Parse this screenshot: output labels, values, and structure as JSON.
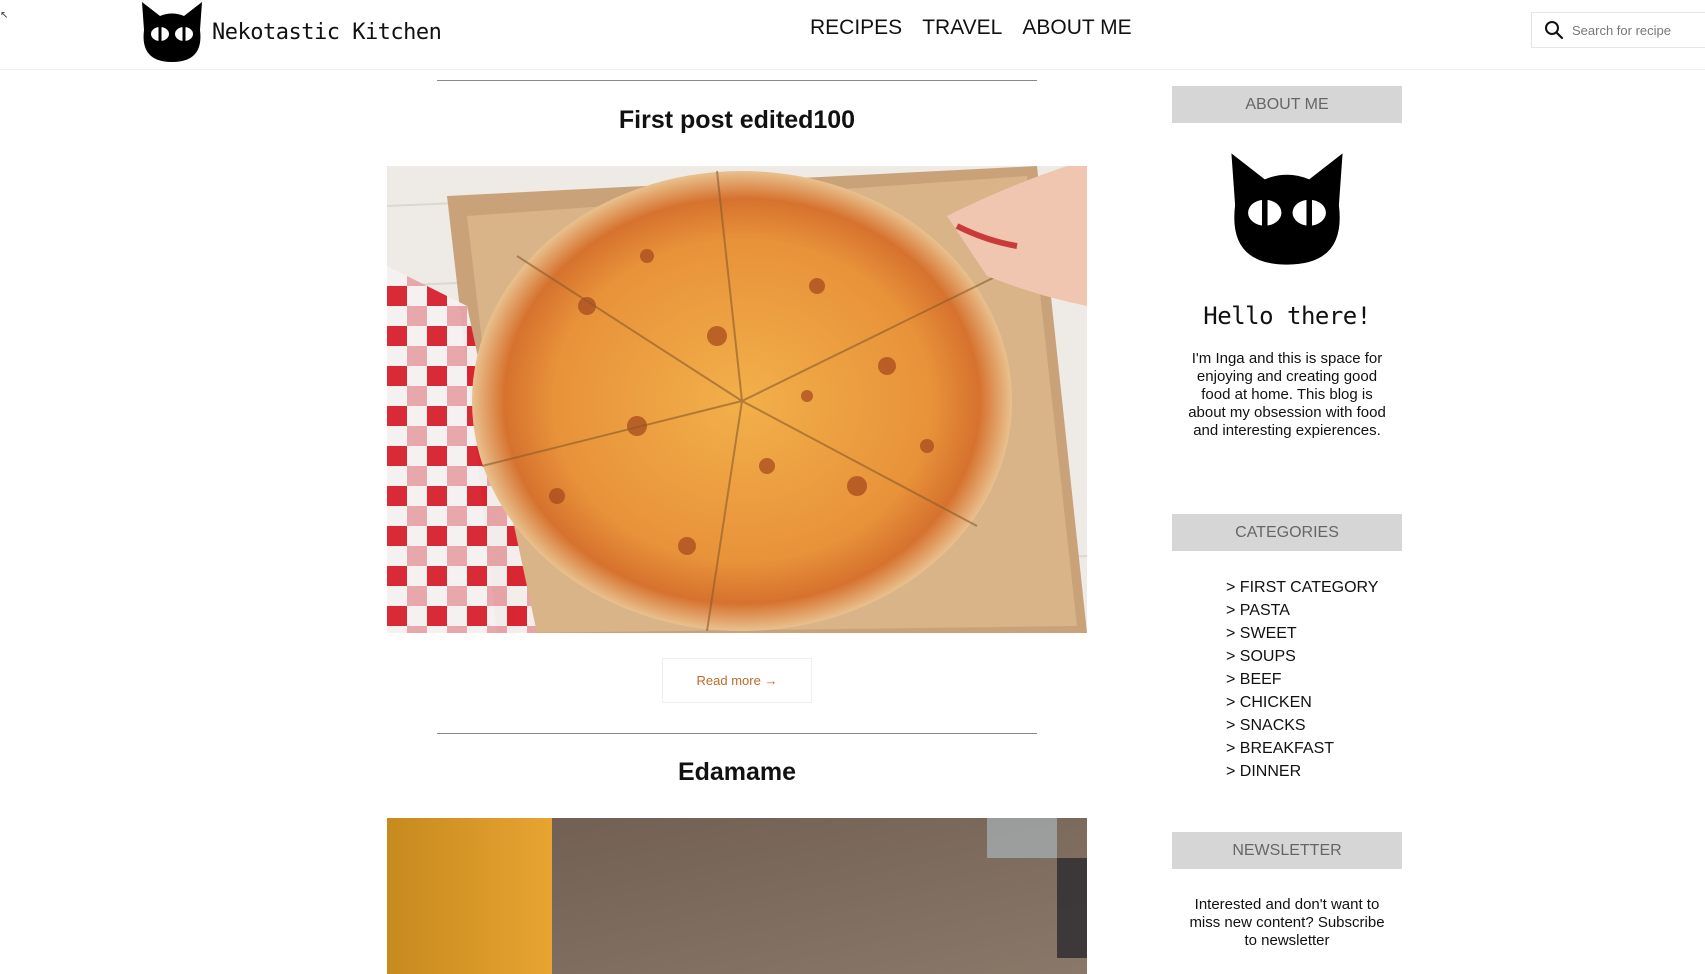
{
  "header": {
    "logo_text": "Nekotastic Kitchen",
    "nav": [
      "RECIPES",
      "TRAVEL",
      "ABOUT ME"
    ],
    "search_placeholder": "Search for recipe"
  },
  "posts": [
    {
      "title": "First post edited100",
      "read_more": "Read more →"
    },
    {
      "title": "Edamame"
    }
  ],
  "sidebar": {
    "about": {
      "heading": "ABOUT ME",
      "greeting": "Hello there!",
      "text": "I'm Inga and this is space for enjoying and creating good food at home. This blog is about my obsession with food and interesting expierences."
    },
    "categories": {
      "heading": "CATEGORIES",
      "items": [
        "> FIRST CATEGORY",
        "> PASTA",
        "> SWEET",
        "> SOUPS",
        "> BEEF",
        "> CHICKEN",
        "> SNACKS",
        "> BREAKFAST",
        "> DINNER"
      ]
    },
    "newsletter": {
      "heading": "NEWSLETTER",
      "text": "Interested and don't want to miss new content? Subscribe to newsletter"
    }
  },
  "colors": {
    "accent": "#c0692c",
    "widget_bg": "#d6d6d6",
    "widget_text": "#666666"
  }
}
